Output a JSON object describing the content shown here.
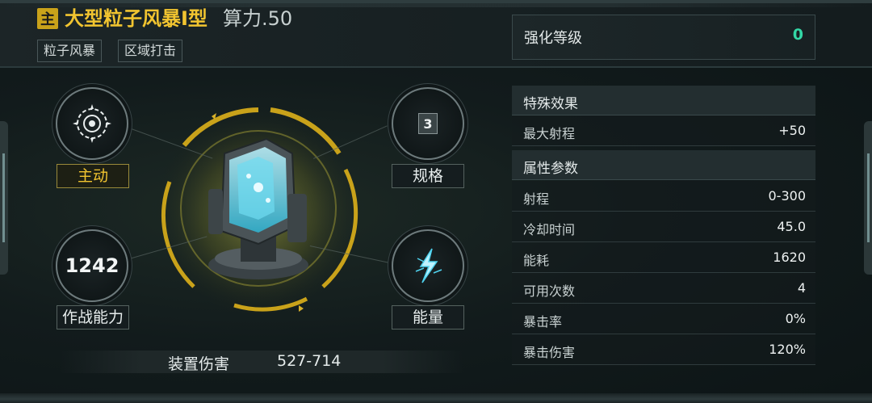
{
  "header": {
    "main_tag": "主",
    "title": "大型粒子风暴I型",
    "power": "算力.50",
    "tags": [
      "粒子风暴",
      "区域打击"
    ]
  },
  "enhance": {
    "label": "强化等级",
    "value": "0"
  },
  "special": {
    "heading": "特殊效果",
    "rows": [
      {
        "k": "最大射程",
        "v": "+50"
      }
    ]
  },
  "attributes": {
    "heading": "属性参数",
    "rows": [
      {
        "k": "射程",
        "v": "0-300"
      },
      {
        "k": "冷却时间",
        "v": "45.0"
      },
      {
        "k": "能耗",
        "v": "1620"
      },
      {
        "k": "可用次数",
        "v": "4"
      },
      {
        "k": "暴击率",
        "v": "0%"
      },
      {
        "k": "暴击伤害",
        "v": "120%"
      }
    ]
  },
  "stats": {
    "active_label": "主动",
    "spec_label": "规格",
    "spec_value": "3",
    "combat_value": "1242",
    "combat_label": "作战能力",
    "energy_label": "能量"
  },
  "damage": {
    "label": "装置伤害",
    "value": "527-714"
  },
  "icons": {
    "active": "particle-ring-icon",
    "energy": "lightning-crystal-icon",
    "device": "particle-storm-device-icon"
  },
  "colors": {
    "accent": "#f1c430",
    "enhance": "#33d8a6"
  }
}
